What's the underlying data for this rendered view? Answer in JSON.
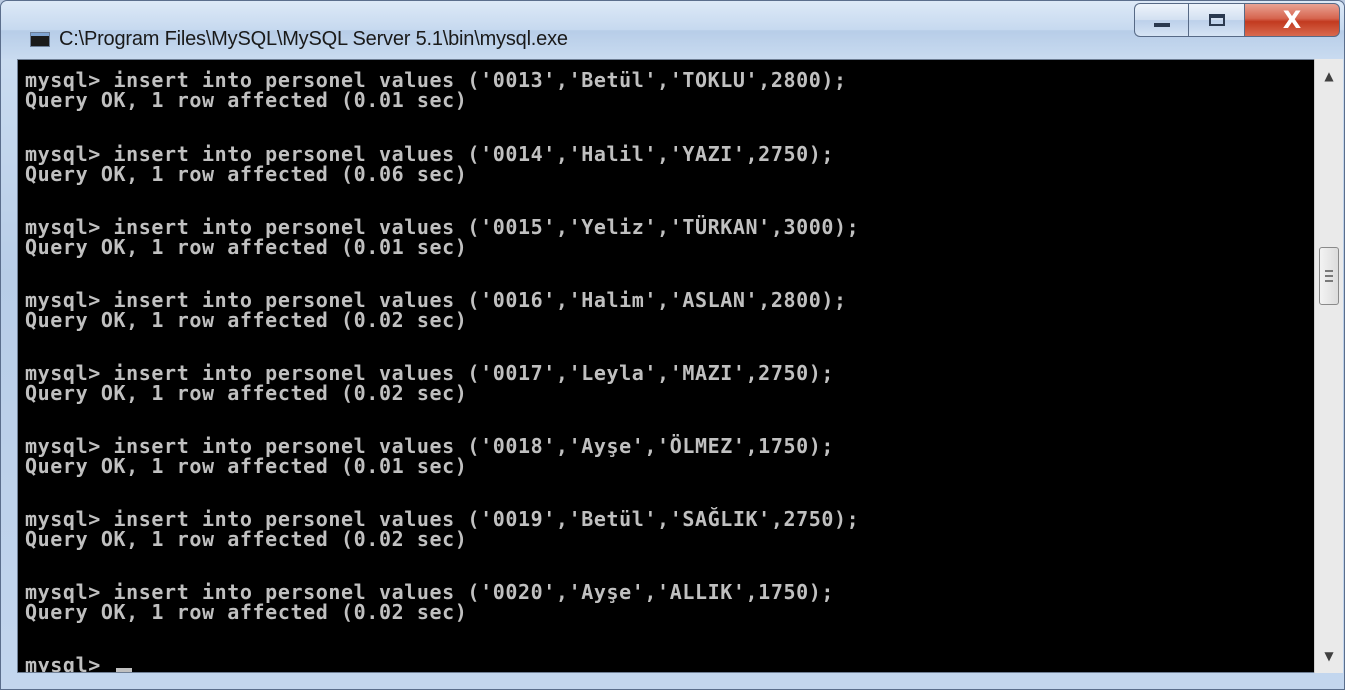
{
  "window": {
    "title": "C:\\Program Files\\MySQL\\MySQL Server 5.1\\bin\\mysql.exe",
    "icon": "console-app-icon",
    "controls": {
      "minimize": "minimize-icon",
      "maximize": "maximize-icon",
      "close": "X"
    }
  },
  "console": {
    "lines": [
      "mysql> insert into personel values ('0013','Betül','TOKLU',2800);",
      "Query OK, 1 row affected (0.01 sec)",
      "mysql> insert into personel values ('0014','Halil','YAZI',2750);",
      "Query OK, 1 row affected (0.06 sec)",
      "mysql> insert into personel values ('0015','Yeliz','TÜRKAN',3000);",
      "Query OK, 1 row affected (0.01 sec)",
      "mysql> insert into personel values ('0016','Halim','ASLAN',2800);",
      "Query OK, 1 row affected (0.02 sec)",
      "mysql> insert into personel values ('0017','Leyla','MAZI',2750);",
      "Query OK, 1 row affected (0.02 sec)",
      "mysql> insert into personel values ('0018','Ayşe','ÖLMEZ',1750);",
      "Query OK, 1 row affected (0.01 sec)",
      "mysql> insert into personel values ('0019','Betül','SAĞLIK',2750);",
      "Query OK, 1 row affected (0.02 sec)",
      "mysql> insert into personel values ('0020','Ayşe','ALLIK',1750);",
      "Query OK, 1 row affected (0.02 sec)"
    ],
    "prompt": "mysql> "
  },
  "colors": {
    "console_bg": "#000000",
    "console_text": "#c0c0c0",
    "close_button": "#c9452a"
  }
}
